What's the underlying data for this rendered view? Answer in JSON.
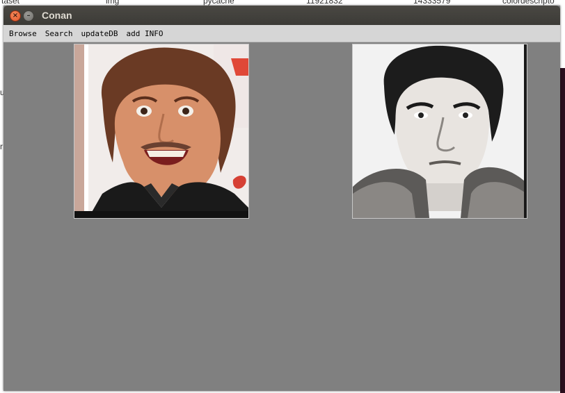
{
  "background": {
    "file_columns": [
      "taset",
      "img",
      "pycache",
      "11921832",
      "14333579",
      "colordescripto"
    ],
    "left_glyphs": [
      "u",
      "r"
    ]
  },
  "window": {
    "title": "Conan",
    "close_glyph": "×",
    "minimize_glyph": "–"
  },
  "menu": {
    "items": [
      {
        "label": "Browse"
      },
      {
        "label": "Search"
      },
      {
        "label": "updateDB"
      },
      {
        "label": "add INFO"
      }
    ]
  },
  "images": {
    "query": {
      "description_icon": "portrait-photo-icon"
    },
    "result": {
      "description_icon": "portrait-photo-icon"
    }
  },
  "colors": {
    "window_bg": "#808080",
    "titlebar": "#3c3b37",
    "menubar": "#d6d6d6",
    "close": "#e0552a"
  }
}
